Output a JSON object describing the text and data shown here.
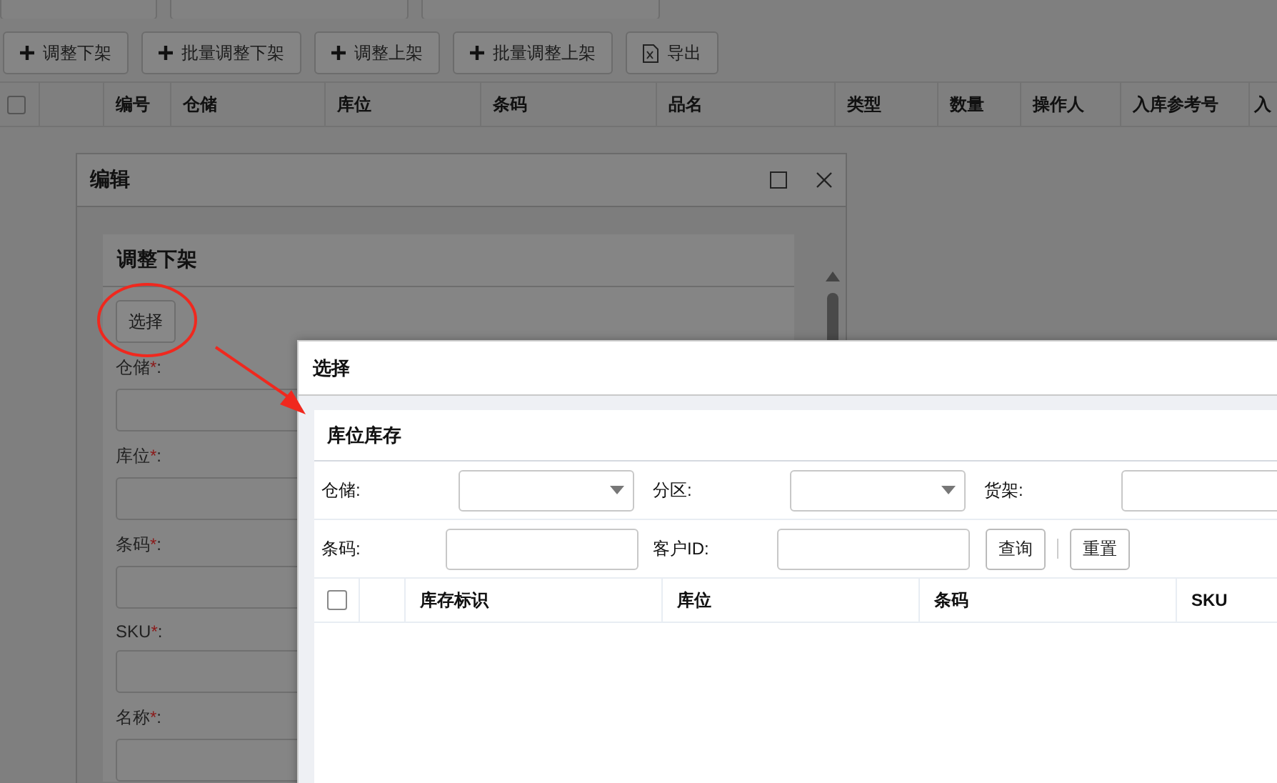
{
  "page": {
    "toolbar": [
      {
        "label": "调整下架",
        "kind": "add"
      },
      {
        "label": "批量调整下架",
        "kind": "add"
      },
      {
        "label": "调整上架",
        "kind": "add"
      },
      {
        "label": "批量调整上架",
        "kind": "add"
      },
      {
        "label": "导出",
        "kind": "export"
      }
    ],
    "table": {
      "header_checkbox": {
        "checked": false
      },
      "columns": [
        "",
        "编号",
        "仓储",
        "库位",
        "条码",
        "品名",
        "类型",
        "数量",
        "操作人",
        "入库参考号",
        "入"
      ]
    }
  },
  "edit_dialog": {
    "title": "编辑",
    "panel_title": "调整下架",
    "select_button": "选择",
    "fields": [
      {
        "label": "仓储",
        "required_mark": "*",
        "suffix": ":"
      },
      {
        "label": "库位",
        "required_mark": "*",
        "suffix": ":"
      },
      {
        "label": "条码",
        "required_mark": "*",
        "suffix": ":"
      },
      {
        "label": "SKU",
        "required_mark": "*",
        "suffix": ":"
      },
      {
        "label": "名称",
        "required_mark": "*",
        "suffix": ":"
      }
    ]
  },
  "select_dialog": {
    "title": "选择",
    "panel_title": "库位库存",
    "filter_rows": [
      [
        {
          "label": "仓储:",
          "kind": "select"
        },
        {
          "label": "分区:",
          "kind": "select"
        },
        {
          "label": "货架:",
          "kind": "input"
        }
      ],
      [
        {
          "label": "条码:",
          "kind": "input"
        },
        {
          "label": "客户ID:",
          "kind": "input"
        }
      ]
    ],
    "buttons": [
      "查询",
      "重置"
    ],
    "table": {
      "header_checkbox": {
        "checked": false
      },
      "columns": [
        "",
        "库存标识",
        "库位",
        "条码",
        "SKU"
      ]
    }
  }
}
